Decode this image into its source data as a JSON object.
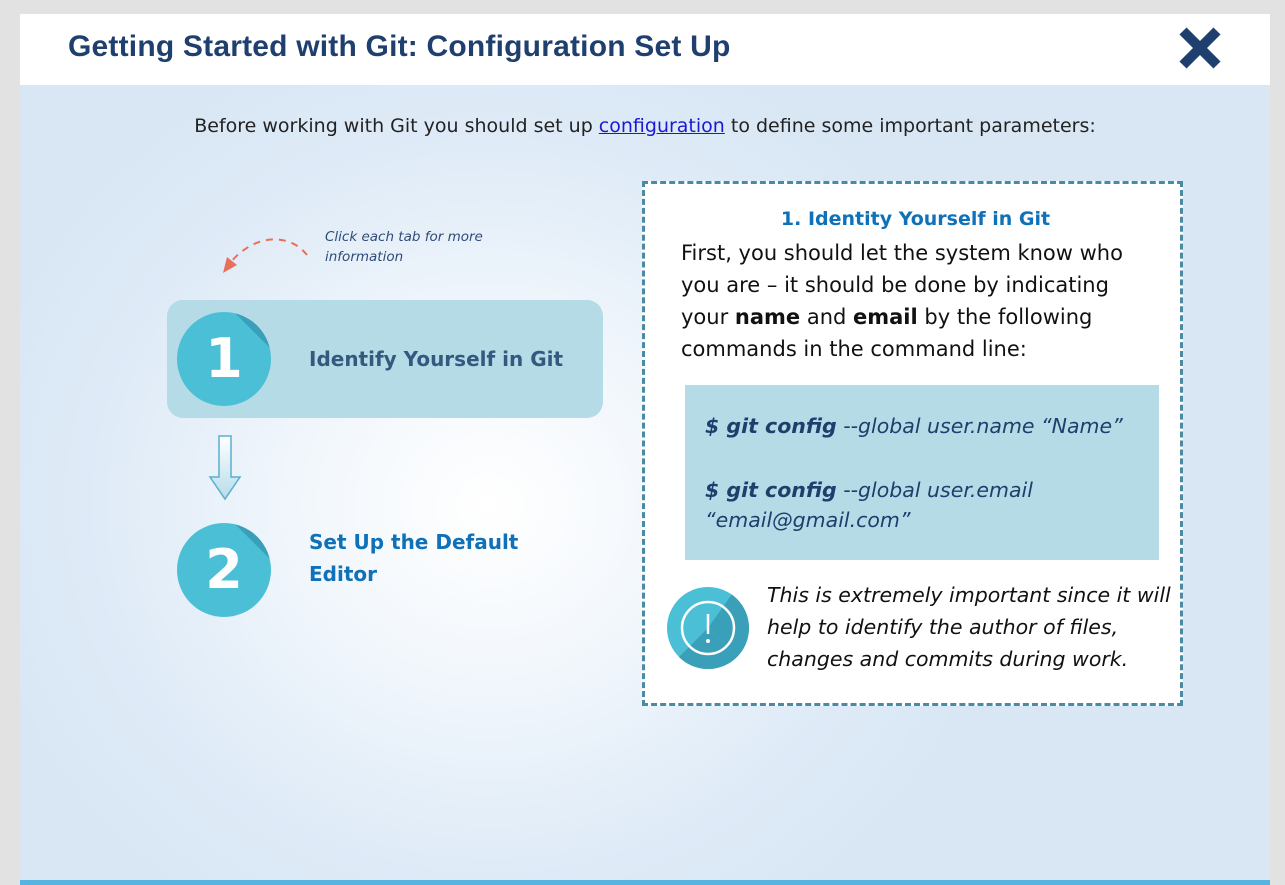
{
  "header": {
    "title": "Getting Started with Git: Configuration Set Up",
    "close_icon": "close-x-icon"
  },
  "intro": {
    "before": "Before working with Git you should set up ",
    "link": "configuration",
    "after": " to define some important parameters:"
  },
  "hint": {
    "text": "Click each tab for more information",
    "icon": "curved-dashed-arrow-icon"
  },
  "tabs": [
    {
      "number": "1",
      "label": "Identify Yourself in Git",
      "active": true
    },
    {
      "number": "2",
      "label": "Set Up the Default Editor",
      "active": false
    }
  ],
  "panel": {
    "title": "1. Identity Yourself in Git",
    "body_before_name": "First, you should let the system know who you are – it should be done by indicating your ",
    "name_word": "name",
    "and_word": " and ",
    "email_word": "email",
    "body_after_email": " by the following commands in the command line:",
    "code": [
      {
        "cmd": "$ git config",
        "args": " --global user.name “Name”"
      },
      {
        "cmd": "$ git config",
        "args": " --global user.email “email@gmail.com”"
      }
    ],
    "note": "This is extremely important since it will help to identify the author of files, changes and commits during work.",
    "note_icon": "exclamation-circle-icon"
  },
  "colors": {
    "title": "#1f3f6e",
    "accent_blue": "#1071b8",
    "tab_active_bg": "#b5dbe6",
    "circle": "#4bbfd6",
    "panel_border": "#4a8aa2",
    "bottom_bar": "#57b3df"
  }
}
